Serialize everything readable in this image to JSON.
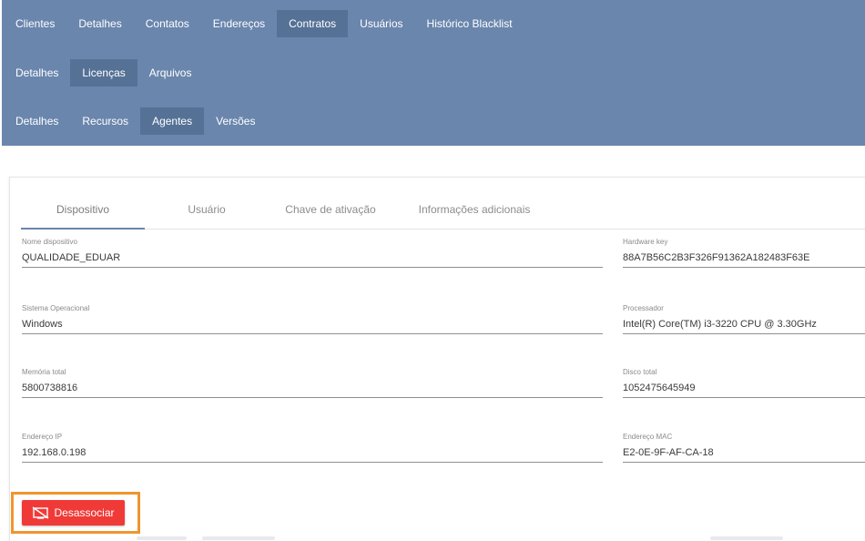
{
  "nav": {
    "row1": [
      "Clientes",
      "Detalhes",
      "Contatos",
      "Endereços",
      "Contratos",
      "Usuários",
      "Histórico Blacklist"
    ],
    "row2": [
      "Detalhes",
      "Licenças",
      "Arquivos"
    ],
    "row3": [
      "Detalhes",
      "Recursos",
      "Agentes",
      "Versões"
    ]
  },
  "tabs": [
    "Dispositivo",
    "Usuário",
    "Chave de ativação",
    "Informações adicionais"
  ],
  "fields": {
    "nome_dispositivo": {
      "label": "Nome dispositivo",
      "value": "QUALIDADE_EDUAR"
    },
    "hardware_key": {
      "label": "Hardware key",
      "value": "88A7B56C2B3F326F91362A182483F63E"
    },
    "sistema_operacional": {
      "label": "Sistema Operacional",
      "value": "Windows"
    },
    "processador": {
      "label": "Processador",
      "value": "Intel(R) Core(TM) i3-3220 CPU @ 3.30GHz"
    },
    "memoria_total": {
      "label": "Memória total",
      "value": "5800738816"
    },
    "disco_total": {
      "label": "Disco total",
      "value": "1052475645949"
    },
    "endereco_ip": {
      "label": "Endereço IP",
      "value": "192.168.0.198"
    },
    "endereco_mac": {
      "label": "Endereço MAC",
      "value": "E2-0E-9F-AF-CA-18"
    }
  },
  "actions": {
    "desassociar_label": "Desassociar",
    "desassociar_icon": "unlink-device-icon"
  },
  "colors": {
    "nav_bg": "#6a86ad",
    "nav_active": "#557196",
    "danger": "#f03a38",
    "highlight": "#f0952e"
  }
}
